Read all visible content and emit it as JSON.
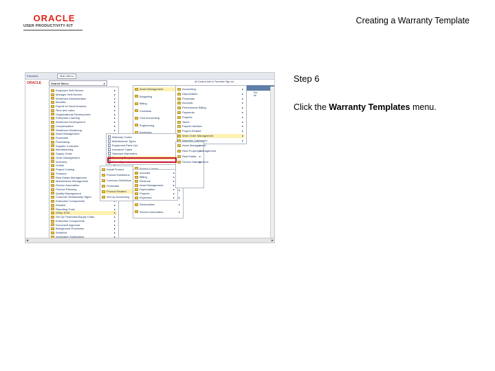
{
  "header": {
    "logo_word": "ORACLE",
    "logo_kit": "USER PRODUCTIVITY KIT",
    "doc_title": "Creating a Warranty Template"
  },
  "step": {
    "label": "Step 6"
  },
  "instruction": {
    "prefix": "Click the ",
    "bold": "Warranty Templates",
    "suffix": " menu."
  },
  "screenshot": {
    "favorites": "Favorites",
    "main_menu": "Main Menu",
    "brand": "ORACLE",
    "nav_links": "All Content   Add to Favorites   Sign out",
    "search_label": "Search Menu:",
    "right_items": [
      "Pre",
      "All"
    ],
    "menu1": [
      "Employee Self-Service",
      "Manager Self-Service",
      "Workforce Administration",
      "Benefits",
      "Payroll for North America",
      "Time and Labor",
      "Organizational Development",
      "Enterprise Learning",
      "Workforce Development",
      "Compensation",
      "Workforce Monitoring",
      "Asset Management",
      "Financials",
      "Purchasing",
      "Supplier Contracts",
      "Manufacturing",
      "Supply Chain",
      "Order Management",
      "Inventory",
      "Grants",
      "Project Costing",
      "Treasury",
      "Real Estate Management",
      "Maintenance Management",
      "Service Automation",
      "Product Planning",
      "Quality Management",
      "Customer Relationship Mgmt",
      "Enterprise Components",
      "Worklist",
      "Reporting Tools",
      "Setup SCM",
      "Set Up Financials/Supply Chain",
      "Enterprise Components",
      "Document Approval",
      "Background Processes",
      "Workflow",
      "Application Diagnostics"
    ],
    "menu2": [
      "Install Product",
      "Product Definitions",
      "Common Definitions",
      "Financials",
      "Product Related",
      "Set Up Accounting"
    ],
    "menu3": [
      "Asset Management",
      "Budgeting",
      "Billing",
      "Contracts",
      "Cost Accounting",
      "Engineering",
      "Expenses",
      "Grants",
      "Inventory",
      "Manufacturing",
      "Order Mgmt",
      "Project Costing",
      "Product Related",
      "Purchasing",
      "Real Estate Management",
      "Maintenance Management",
      "Receivables",
      "Service Automation"
    ],
    "menu4": [
      "Accounting",
      "Depreciation",
      "Financials",
      "Accruals",
      "Performance Billing",
      "Payments",
      "Projects",
      "Taxes",
      "Payroll Interface",
      "Project Related",
      "Work Order Management",
      "Warranty Categories"
    ],
    "menu5": [
      "Warranty Codes",
      "Maintenance Types",
      "Equipment Parts List",
      "Insurance Types",
      "Standard Warranties",
      "Warranty Templates",
      "Meter Types"
    ],
    "menu6": [
      "Accruals",
      "Billing",
      "Revenue",
      "Asset Management",
      "Depreciation",
      "Projects",
      "Expenses"
    ],
    "menu7": [
      "Asset Management",
      "Rent Property Management",
      "Real Estate",
      "Service Management"
    ]
  }
}
